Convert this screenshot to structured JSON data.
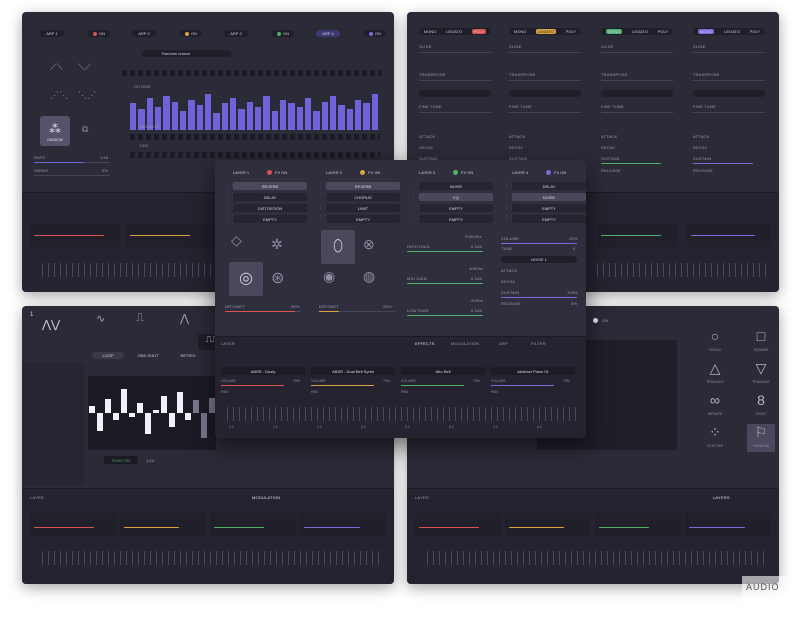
{
  "arp": {
    "buttons": [
      "ARP 1",
      "ARP 2",
      "ARP 3",
      "ARP 4"
    ],
    "toggle": "ON",
    "pattern": "Random unison",
    "randomize": "RANDOM",
    "rate": "RATE",
    "rate_val": "1/16",
    "swing": "SWING",
    "swing_val": "0%",
    "octave": "OCTAVE",
    "velocity": "VELOCITY",
    "len": "LEN",
    "bar_values": [
      0.7,
      0.55,
      0.85,
      0.6,
      0.9,
      0.75,
      0.5,
      0.8,
      0.65,
      0.95,
      0.45,
      0.7,
      0.85,
      0.55,
      0.75,
      0.6,
      0.9,
      0.5,
      0.8,
      0.7,
      0.6,
      0.85,
      0.5,
      0.75,
      0.9,
      0.65,
      0.55,
      0.8,
      0.7,
      0.95
    ]
  },
  "env": {
    "tabs": [
      "MONO",
      "LEGATO",
      "POLY"
    ],
    "slide": "SLIDE",
    "transpose": "TRANSPOSE",
    "fine_tune": "FINE TUNE",
    "attack": "ATTACK",
    "decay": "DECAY",
    "sustain": "SUSTAIN",
    "release": "RELEASE",
    "pct": "0%",
    "pct_full": "100%"
  },
  "fx": {
    "layers": [
      "LAYER 1",
      "LAYER 2",
      "LAYER 3",
      "LAYER 4"
    ],
    "fx_on": "FX ON",
    "slots": [
      [
        "REVERB",
        "DELAY",
        "DISTORTION",
        "EMPTY"
      ],
      [
        "REVERB",
        "CHORUS",
        "LIMIT",
        "EMPTY"
      ],
      [
        "NOISE",
        "EQ",
        "EMPTY",
        "EMPTY"
      ],
      [
        "DELAY",
        "NOISE",
        "EMPTY",
        "EMPTY"
      ]
    ],
    "dry_wet": "DRY/WET",
    "dry_wet_val_1": "95%",
    "dry_wet_val_2": "25%",
    "high_gain": "HIGH GAIN",
    "mid_gain": "MID GAIN",
    "low_gain": "LOW GAIN",
    "db": "0.0db",
    "hz_hi": "20000hz",
    "hz_mid": "4000hz",
    "hz_lo": "200hz",
    "volume": "VOLUME",
    "volume_val": "25%",
    "tune": "TUNE",
    "tune_val": "0",
    "noise1": "NOISE 1",
    "n_attack": "ATTACK",
    "n_decay": "DECAY",
    "n_sustain": "SUSTAIN",
    "n_release": "RELEASE",
    "n_sustain_val": "100%",
    "n_val": "0%"
  },
  "lfo": {
    "number": "1",
    "tabs": [
      "LOOP",
      "ONE-SHOT",
      "RETRIG"
    ],
    "sync": "SYNC ON",
    "rate_label": "1/16",
    "bars": [
      0.1,
      -0.25,
      0.2,
      -0.1,
      0.35,
      -0.05,
      0.15,
      -0.3,
      0.05,
      0.25,
      -0.2,
      0.3,
      -0.1,
      0.18,
      -0.35,
      0.22
    ]
  },
  "shapes": {
    "toggle": "ON",
    "items": [
      {
        "icon": "○",
        "label": "CIRCLE"
      },
      {
        "icon": "□",
        "label": "SQUARE"
      },
      {
        "icon": "△",
        "label": "TRIANGLE"
      },
      {
        "icon": "▽",
        "label": "TRIANGLE"
      },
      {
        "icon": "∞",
        "label": "INFINITE"
      },
      {
        "icon": "8",
        "label": "EIGHT"
      },
      {
        "icon": "⁘",
        "label": "SCATTER"
      },
      {
        "icon": "⚐",
        "label": "RANDOM"
      }
    ]
  },
  "mixer": {
    "top_labels": [
      "LAYER",
      "EFFECTS",
      "MODULATION",
      "ARP",
      "FILTER",
      "LAYERS"
    ],
    "slots": [
      {
        "name": "ABSR - Dusty",
        "color": "#d9534f"
      },
      {
        "name": "ABSR - Dual Bell Synth",
        "color": "#d9a441"
      },
      {
        "name": "Afro Bell",
        "color": "#4fb36a"
      },
      {
        "name": "Abstract Piano 01",
        "color": "#7d6bdc"
      }
    ],
    "volume": "VOLUME",
    "vol_val": "75%",
    "pan": "PAN",
    "fine": "FINE",
    "bar_numbers": [
      "1.1",
      "1.2",
      "2.1",
      "2.2",
      "3.1",
      "3.2",
      "4.1",
      "4.2"
    ]
  },
  "watermark": "AUDIO",
  "colors": {
    "accent": "#7062d8",
    "red": "#d9534f",
    "orange": "#d9a441",
    "green": "#4fb36a",
    "purple": "#7d6bdc",
    "panel": "#2b2a37"
  }
}
